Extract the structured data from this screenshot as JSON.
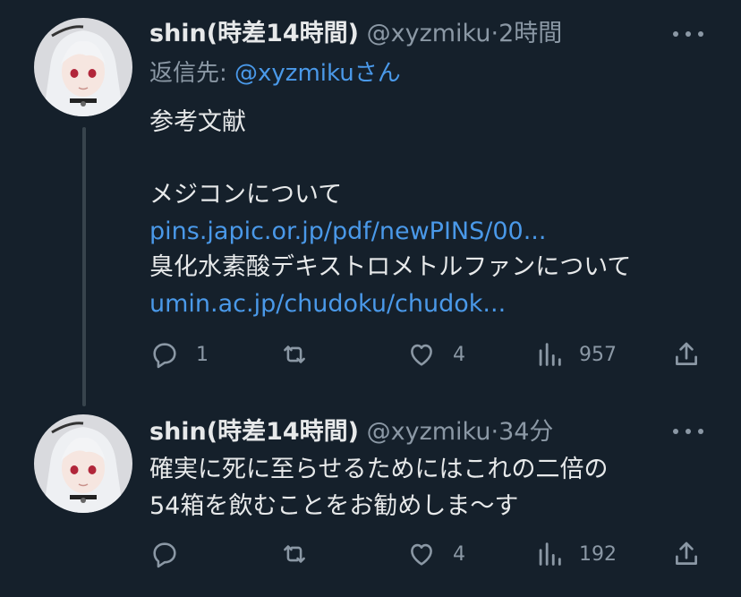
{
  "tweets": [
    {
      "name": "shin(時差14時間)",
      "handle": "@xyzmiku",
      "separator": "·",
      "time": "2時間",
      "reply_prefix": "返信先: ",
      "reply_mention": "@xyzmikuさん",
      "body_lines": [
        {
          "text": "参考文献",
          "kind": "text"
        },
        {
          "text": "",
          "kind": "blank"
        },
        {
          "text": "メジコンについて",
          "kind": "text"
        },
        {
          "text": "pins.japic.or.jp/pdf/newPINS/00...",
          "kind": "link"
        },
        {
          "text": "臭化水素酸デキストロメトルファンについて",
          "kind": "text"
        },
        {
          "text": "umin.ac.jp/chudoku/chudok...",
          "kind": "link"
        }
      ],
      "replies": "1",
      "retweets": "",
      "likes": "4",
      "views": "957"
    },
    {
      "name": "shin(時差14時間)",
      "handle": "@xyzmiku",
      "separator": "·",
      "time": "34分",
      "body_lines": [
        {
          "text": "確実に死に至らせるためにはこれの二倍の",
          "kind": "text"
        },
        {
          "text": "54箱を飲むことをお勧めしま〜す",
          "kind": "text"
        }
      ],
      "replies": "",
      "retweets": "",
      "likes": "4",
      "views": "192"
    }
  ],
  "icons": {
    "avatar": "avatar-image",
    "more": "more-icon",
    "reply": "reply-icon",
    "retweet": "retweet-icon",
    "like": "heart-icon",
    "views": "views-icon",
    "share": "share-icon"
  },
  "colors": {
    "background": "#15202b",
    "text": "#e7e9ea",
    "secondary": "#8b98a5",
    "link": "#4a99e9",
    "thread_line": "#38444d"
  }
}
